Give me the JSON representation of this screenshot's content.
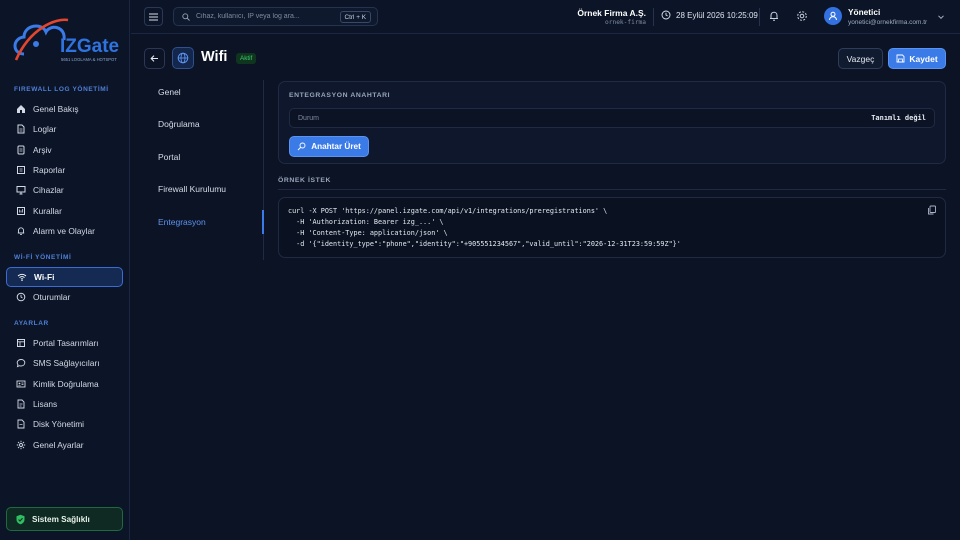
{
  "brand": {
    "name": "IZGate",
    "tagline": "5651 LOGLAMA & HOTSPOT"
  },
  "colors": {
    "accent": "#3b7be8",
    "success": "#3ecb6e",
    "background": "#0b1324"
  },
  "sidebar": {
    "sections": [
      {
        "label": "FIREWALL LOG YÖNETİMİ",
        "items": [
          {
            "label": "Genel Bakış",
            "icon": "home-icon"
          },
          {
            "label": "Loglar",
            "icon": "file-icon"
          },
          {
            "label": "Arşiv",
            "icon": "archive-icon"
          },
          {
            "label": "Raporlar",
            "icon": "report-icon"
          },
          {
            "label": "Cihazlar",
            "icon": "monitor-icon"
          },
          {
            "label": "Kurallar",
            "icon": "rules-icon"
          },
          {
            "label": "Alarm ve Olaylar",
            "icon": "bell-icon"
          }
        ]
      },
      {
        "label": "Wİ-Fİ YÖNETİMİ",
        "items": [
          {
            "label": "Wi-Fi",
            "icon": "wifi-icon",
            "active": true
          },
          {
            "label": "Oturumlar",
            "icon": "clock-icon"
          }
        ]
      },
      {
        "label": "AYARLAR",
        "items": [
          {
            "label": "Portal Tasarımları",
            "icon": "layout-icon"
          },
          {
            "label": "SMS Sağlayıcıları",
            "icon": "message-icon"
          },
          {
            "label": "Kimlik Doğrulama",
            "icon": "id-card-icon"
          },
          {
            "label": "Lisans",
            "icon": "license-icon"
          },
          {
            "label": "Disk Yönetimi",
            "icon": "disk-icon"
          },
          {
            "label": "Genel Ayarlar",
            "icon": "gear-icon"
          }
        ]
      }
    ],
    "health_label": "Sistem Sağlıklı"
  },
  "topbar": {
    "search_placeholder": "Cihaz, kullanıcı, IP veya log ara...",
    "search_shortcut": "Ctrl + K",
    "org_name": "Örnek Firma A.Ş.",
    "org_slug": "ornek-firma",
    "datetime": "28 Eylül 2026 10:25:09",
    "user_name": "Yönetici",
    "user_email": "yonetici@ornekfirma.com.tr"
  },
  "page": {
    "title": "Wifi",
    "status": "Aktif",
    "cancel_label": "Vazgeç",
    "save_label": "Kaydet"
  },
  "tabs": [
    {
      "label": "Genel"
    },
    {
      "label": "Doğrulama"
    },
    {
      "label": "Portal"
    },
    {
      "label": "Firewall Kurulumu"
    },
    {
      "label": "Entegrasyon",
      "active": true
    }
  ],
  "integration": {
    "title": "ENTEGRASYON ANAHTARI",
    "status_label": "Durum",
    "status_value": "Tanımlı değil",
    "generate_label": "Anahtar Üret"
  },
  "example": {
    "title": "ÖRNEK İSTEK",
    "code_lines": [
      "curl -X POST 'https://panel.izgate.com/api/v1/integrations/preregistrations' \\",
      "  -H 'Authorization: Bearer izg_...' \\",
      "  -H 'Content-Type: application/json' \\",
      "  -d '{\"identity_type\":\"phone\",\"identity\":\"+905551234567\",\"valid_until\":\"2026-12-31T23:59:59Z\"}'"
    ]
  }
}
